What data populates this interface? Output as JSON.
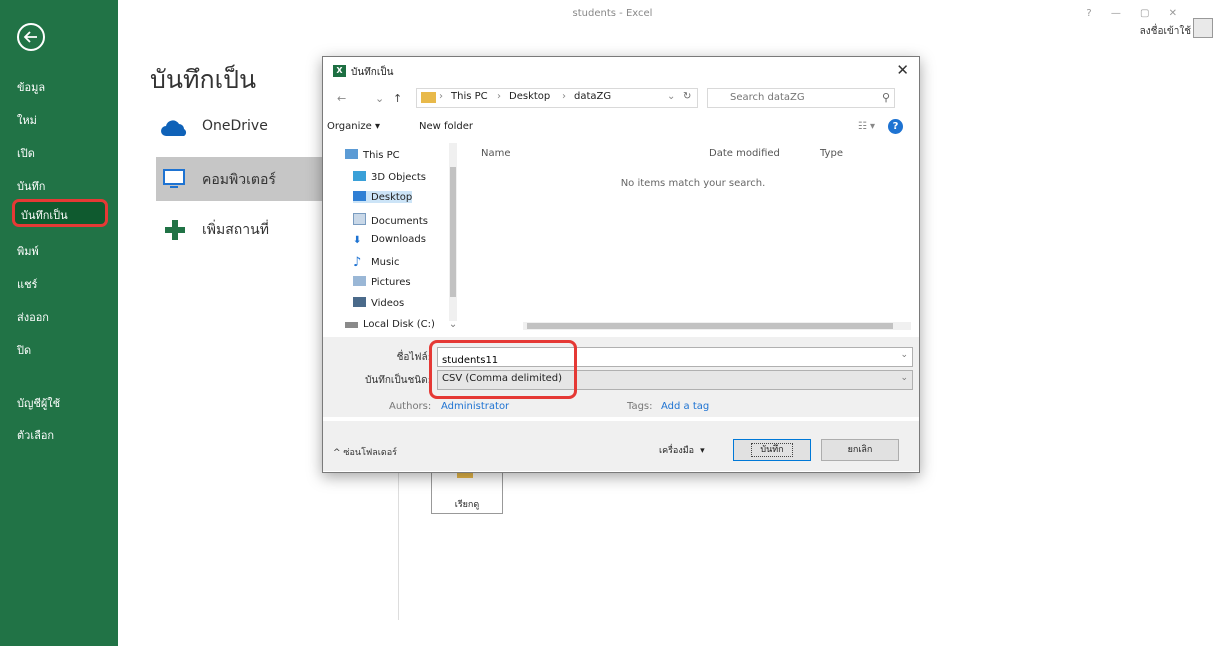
{
  "window": {
    "title": "students - Excel",
    "controls": "?  —  ▢  ✕",
    "signin": "ลงชื่อเข้าใช้"
  },
  "sidebar": {
    "items": [
      {
        "label": "ข้อมูล"
      },
      {
        "label": "ใหม่"
      },
      {
        "label": "เปิด"
      },
      {
        "label": "บันทึก"
      },
      {
        "label": "บันทึกเป็น",
        "active": true
      },
      {
        "label": "พิมพ์"
      },
      {
        "label": "แชร์"
      },
      {
        "label": "ส่งออก"
      },
      {
        "label": "ปิด"
      },
      {
        "label": "บัญชีผู้ใช้"
      },
      {
        "label": "ตัวเลือก"
      }
    ]
  },
  "saveas": {
    "heading": "บันทึกเป็น",
    "locations": [
      {
        "label": "OneDrive"
      },
      {
        "label": "คอมพิวเตอร์"
      },
      {
        "label": "เพิ่มสถานที่"
      }
    ],
    "recent_folder": "เรียกดู"
  },
  "dialog": {
    "title": "บันทึกเป็น",
    "path": [
      "This PC",
      "Desktop",
      "dataZG"
    ],
    "search_placeholder": "Search dataZG",
    "organize": "Organize ▾",
    "new_folder": "New folder",
    "tree": [
      "This PC",
      "3D Objects",
      "Desktop",
      "Documents",
      "Downloads",
      "Music",
      "Pictures",
      "Videos",
      "Local Disk (C:)"
    ],
    "columns": {
      "name": "Name",
      "date": "Date modified",
      "type": "Type"
    },
    "empty_message": "No items match your search.",
    "file_name_label": "ชื่อไฟล์:",
    "file_name": "students11",
    "save_type_label": "บันทึกเป็นชนิด:",
    "save_type": "CSV (Comma delimited)",
    "authors_label": "Authors:",
    "authors": "Administrator",
    "tags_label": "Tags:",
    "tags": "Add a tag",
    "hide_folders": "ซ่อนโฟลเดอร์",
    "tools": "เครื่องมือ",
    "save_button": "บันทึก",
    "cancel_button": "ยกเลิก"
  },
  "colors": {
    "excel_green": "#217346",
    "highlight_red": "#e53935"
  }
}
